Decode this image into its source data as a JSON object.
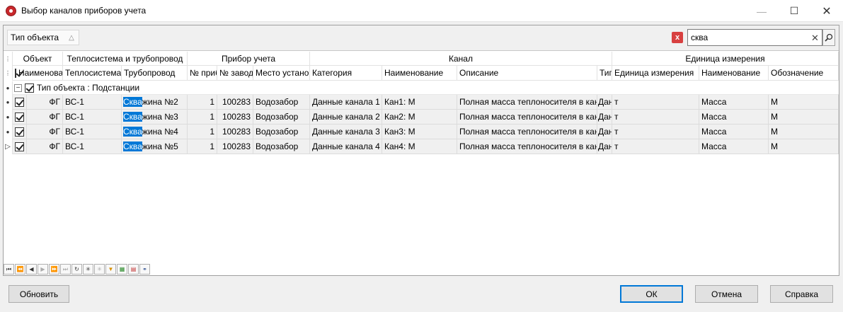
{
  "window": {
    "title": "Выбор каналов приборов учета"
  },
  "group_panel": {
    "chip_label": "Тип объекта"
  },
  "search": {
    "value": "сква",
    "clear_label": "x"
  },
  "columns": {
    "bands": [
      {
        "label": "Объект"
      },
      {
        "label": "Теплосистема и трубопровод"
      },
      {
        "label": "Прибор учета"
      },
      {
        "label": "Канал"
      },
      {
        "label": "Единица измерения"
      }
    ],
    "headers": [
      "Наименование",
      "Теплосистема",
      "Трубопровод",
      "№ прибора",
      "№ заводской",
      "Место установки",
      "Категория",
      "Наименование",
      "Описание",
      "Тип",
      "Единица измерения",
      "Наименование",
      "Обозначение"
    ]
  },
  "group_row": {
    "label": "Тип объекта : Подстанции"
  },
  "rows": [
    {
      "name": "ФГ",
      "heat": "ВС-1",
      "pipe_hl": "Сква",
      "pipe_rest": "жина №2",
      "num": "1",
      "serial": "100283",
      "place": "Водозабор",
      "category": "Данные канала 1",
      "ch_name": "Кан1: М",
      "desc": "Полная масса теплоносителя в канале",
      "type": "Данные",
      "unit": "т",
      "unit_name": "Масса",
      "unit_sym": "М"
    },
    {
      "name": "ФГ",
      "heat": "ВС-1",
      "pipe_hl": "Сква",
      "pipe_rest": "жина №3",
      "num": "1",
      "serial": "100283",
      "place": "Водозабор",
      "category": "Данные канала 2",
      "ch_name": "Кан2: М",
      "desc": "Полная масса теплоносителя в канале",
      "type": "Данные",
      "unit": "т",
      "unit_name": "Масса",
      "unit_sym": "М"
    },
    {
      "name": "ФГ",
      "heat": "ВС-1",
      "pipe_hl": "Сква",
      "pipe_rest": "жина №4",
      "num": "1",
      "serial": "100283",
      "place": "Водозабор",
      "category": "Данные канала 3",
      "ch_name": "Кан3: М",
      "desc": "Полная масса теплоносителя в канале",
      "type": "Данные",
      "unit": "т",
      "unit_name": "Масса",
      "unit_sym": "М"
    },
    {
      "name": "ФГ",
      "heat": "ВС-1",
      "pipe_hl": "Сква",
      "pipe_rest": "жина №5",
      "num": "1",
      "serial": "100283",
      "place": "Водозабор",
      "category": "Данные канала 4",
      "ch_name": "Кан4: М",
      "desc": "Полная масса теплоносителя в канале",
      "type": "Данные",
      "unit": "т",
      "unit_name": "Масса",
      "unit_sym": "М"
    }
  ],
  "buttons": {
    "refresh": "Обновить",
    "ok": "ОК",
    "cancel": "Отмена",
    "help": "Справка"
  },
  "colors": {
    "selection": "#0078d7",
    "clear_red": "#d84040"
  }
}
